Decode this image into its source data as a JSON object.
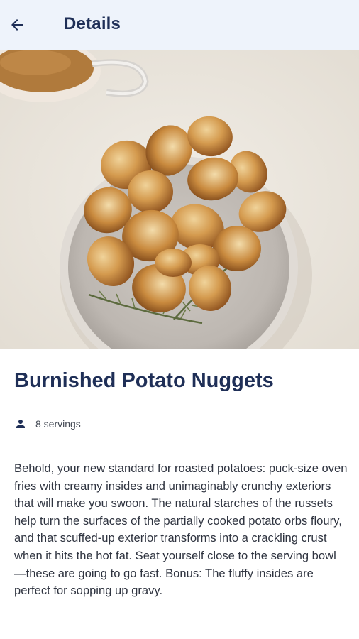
{
  "header": {
    "title": "Details"
  },
  "icons": {
    "back": "arrow-left-icon",
    "servings": "person-icon"
  },
  "recipe": {
    "title": "Burnished Potato Nuggets",
    "servings": "8 servings",
    "description": "Behold, your new standard for roasted potatoes: puck-size oven fries with creamy insides and unimaginably crunchy exteriors that will make you swoon. The natural starches of the russets help turn the surfaces of the partially cooked potato orbs floury, and that scuffed-up exterior transforms into a crackling crust when it hits the hot fat. Seat yourself close to the serving bowl—these are going to go fast. Bonus: The fluffy insides are perfect for sopping up gravy."
  },
  "colors": {
    "appbar_bg": "#eef3fb",
    "title_color": "#1f2f57"
  }
}
